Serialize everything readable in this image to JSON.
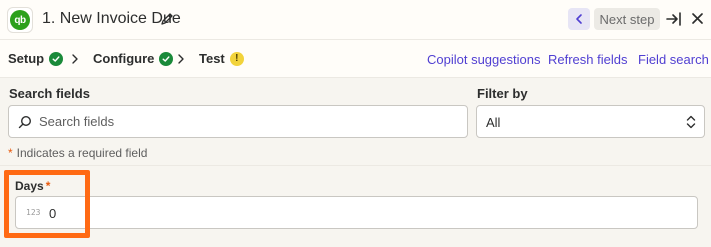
{
  "header": {
    "app_logo_text": "qb",
    "title": "1. New Invoice Due",
    "next_step_label": "Next step"
  },
  "tabs": [
    {
      "label": "Setup",
      "status": "complete"
    },
    {
      "label": "Configure",
      "status": "complete"
    },
    {
      "label": "Test",
      "status": "warning",
      "badge": "!"
    }
  ],
  "links": {
    "copilot": "Copilot suggestions",
    "refresh": "Refresh fields",
    "field_search": "Field search"
  },
  "search": {
    "label": "Search fields",
    "placeholder": "Search fields",
    "value": ""
  },
  "filter": {
    "label": "Filter by",
    "selected": "All"
  },
  "required_note": {
    "star": "*",
    "text": "Indicates a required field"
  },
  "days_field": {
    "label": "Days",
    "required_star": "*",
    "type_hint": "123",
    "value": "0"
  },
  "colors": {
    "accent": "#503fd2",
    "success": "#1a8a3a",
    "warning": "#f2d33b",
    "highlight": "#ff6a14",
    "required": "#e8590c",
    "brand": "#2ca01c"
  }
}
